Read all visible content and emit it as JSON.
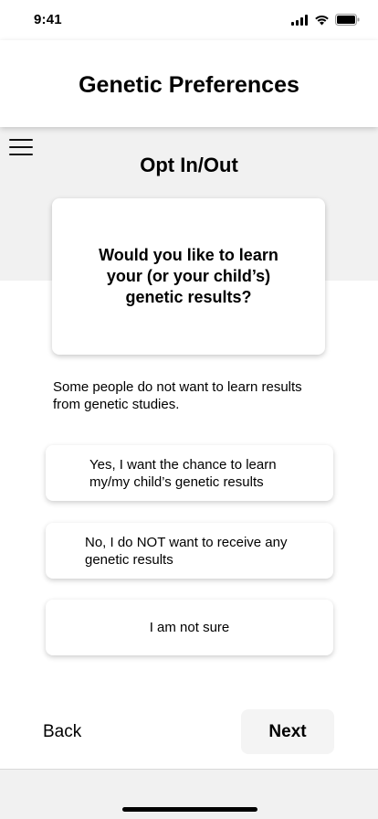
{
  "status_bar": {
    "time": "9:41"
  },
  "header": {
    "title": "Genetic Preferences"
  },
  "section": {
    "title": "Opt In/Out"
  },
  "question": {
    "text": "Would you like to learn your (or your child’s) genetic results?"
  },
  "intro": {
    "text": "Some people do not want to learn results from genetic studies."
  },
  "options": [
    {
      "label": "Yes, I want the chance to learn my/my child’s genetic results"
    },
    {
      "label": "No, I do NOT want to receive any genetic results"
    },
    {
      "label": "I am not sure"
    }
  ],
  "footer": {
    "back_label": "Back",
    "next_label": "Next"
  }
}
